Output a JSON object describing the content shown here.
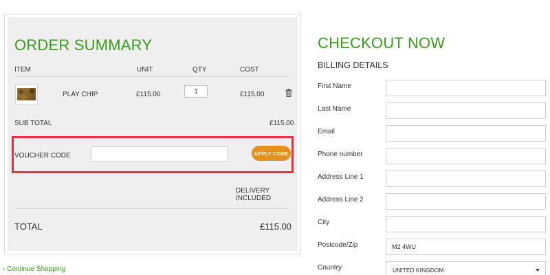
{
  "order_summary": {
    "title": "ORDER SUMMARY",
    "columns": {
      "item": "ITEM",
      "unit": "UNIT",
      "qty": "QTY",
      "cost": "COST"
    },
    "row": {
      "name": "PLAY CHIP",
      "unit": "£115.00",
      "qty": "1",
      "cost": "£115.00",
      "delete_icon": "trash-icon"
    },
    "subtotal_label": "SUB TOTAL",
    "subtotal_value": "£115.00",
    "voucher_label": "VOUCHER CODE",
    "voucher_value": "",
    "apply_label": "APPLY CODE",
    "delivery_label": "DELIVERY INCLUDED",
    "total_label": "TOTAL",
    "total_value": "£115.00"
  },
  "continue_link": "Continue Shopping",
  "checkout": {
    "title": "CHECKOUT NOW",
    "billing_heading": "BILLING DETAILS",
    "fields": {
      "first_name": {
        "label": "First Name",
        "value": ""
      },
      "last_name": {
        "label": "Last Name",
        "value": ""
      },
      "email": {
        "label": "Email",
        "value": ""
      },
      "phone": {
        "label": "Phone number",
        "value": ""
      },
      "address1": {
        "label": "Address Line 1",
        "value": ""
      },
      "address2": {
        "label": "Address Line 2",
        "value": ""
      },
      "city": {
        "label": "City",
        "value": ""
      },
      "postcode": {
        "label": "Postcode/Zip",
        "value": "M2 4WU"
      },
      "country": {
        "label": "Country",
        "value": "UNITED KINGDOM"
      }
    }
  },
  "colors": {
    "accent_green": "#3a9a1c",
    "button_orange": "#e3901f",
    "highlight_red": "#e8333b"
  }
}
